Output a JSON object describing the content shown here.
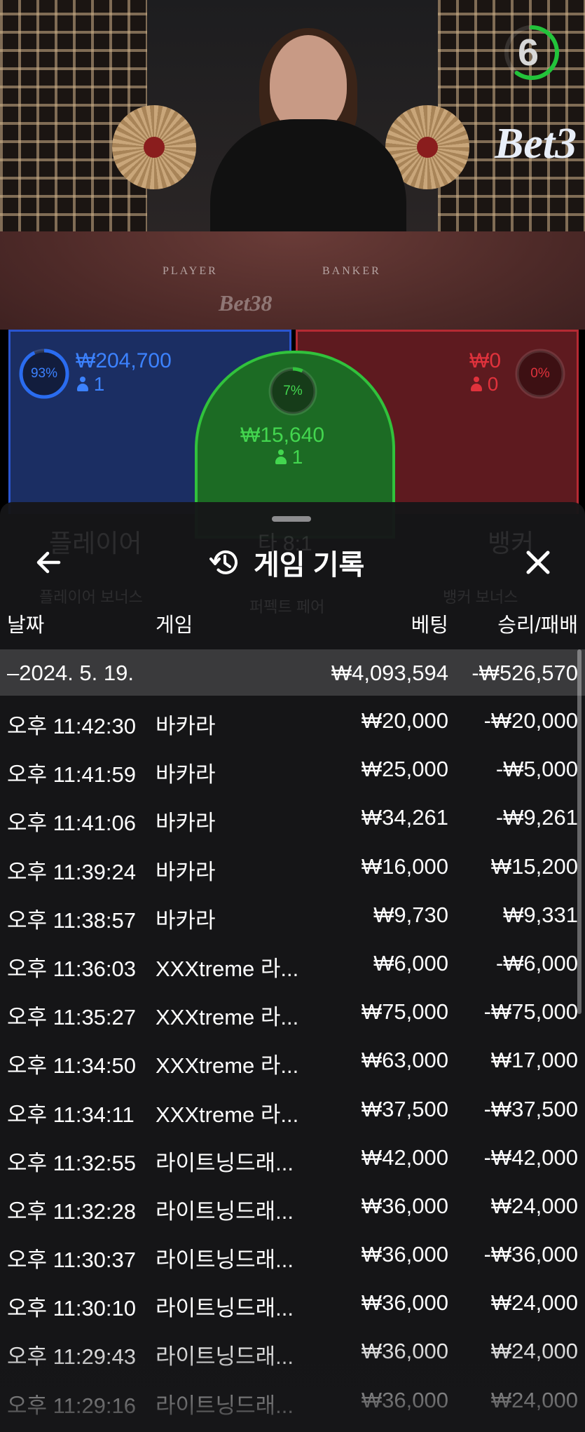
{
  "timer": {
    "seconds": "6",
    "progress": 0.6,
    "color": "#22c33a"
  },
  "video": {
    "felt_player": "PLAYER",
    "felt_banker": "BANKER",
    "watermark": "Bet38",
    "brand_right": "Bet3"
  },
  "bets": {
    "player": {
      "amount": "₩204,700",
      "count": "1",
      "percent": "93%",
      "percent_value": 0.93,
      "color": "#2a6cf0"
    },
    "tie": {
      "amount": "₩15,640",
      "count": "1",
      "percent": "7%",
      "percent_value": 0.07,
      "color": "#31c23c"
    },
    "banker": {
      "amount": "₩0",
      "count": "0",
      "percent": "0%",
      "percent_value": 0,
      "color": "#d2232f"
    }
  },
  "background_panel": {
    "player_label": "플레이어",
    "tie_label": "타 8:1",
    "banker_label": "뱅커",
    "player_bonus": "플레이어 보너스",
    "tie_bonus": "퍼펙트 페어",
    "banker_bonus": "뱅커 보너스"
  },
  "history": {
    "title": "게임 기록",
    "columns": {
      "date": "날짜",
      "game": "게임",
      "bet": "베팅",
      "winloss": "승리/패배"
    },
    "summary": {
      "date": "–2024. 5. 19.",
      "bet": "₩4,093,594",
      "winloss": "-₩526,570"
    },
    "rows": [
      {
        "time": "오후 11:42:30",
        "game": "바카라",
        "bet": "₩20,000",
        "winloss": "-₩20,000"
      },
      {
        "time": "오후 11:41:59",
        "game": "바카라",
        "bet": "₩25,000",
        "winloss": "-₩5,000"
      },
      {
        "time": "오후 11:41:06",
        "game": "바카라",
        "bet": "₩34,261",
        "winloss": "-₩9,261"
      },
      {
        "time": "오후 11:39:24",
        "game": "바카라",
        "bet": "₩16,000",
        "winloss": "₩15,200"
      },
      {
        "time": "오후 11:38:57",
        "game": "바카라",
        "bet": "₩9,730",
        "winloss": "₩9,331"
      },
      {
        "time": "오후 11:36:03",
        "game": "XXXtreme 라...",
        "bet": "₩6,000",
        "winloss": "-₩6,000"
      },
      {
        "time": "오후 11:35:27",
        "game": "XXXtreme 라...",
        "bet": "₩75,000",
        "winloss": "-₩75,000"
      },
      {
        "time": "오후 11:34:50",
        "game": "XXXtreme 라...",
        "bet": "₩63,000",
        "winloss": "₩17,000"
      },
      {
        "time": "오후 11:34:11",
        "game": "XXXtreme 라...",
        "bet": "₩37,500",
        "winloss": "-₩37,500"
      },
      {
        "time": "오후 11:32:55",
        "game": "라이트닝드래...",
        "bet": "₩42,000",
        "winloss": "-₩42,000"
      },
      {
        "time": "오후 11:32:28",
        "game": "라이트닝드래...",
        "bet": "₩36,000",
        "winloss": "₩24,000"
      },
      {
        "time": "오후 11:30:37",
        "game": "라이트닝드래...",
        "bet": "₩36,000",
        "winloss": "-₩36,000"
      },
      {
        "time": "오후 11:30:10",
        "game": "라이트닝드래...",
        "bet": "₩36,000",
        "winloss": "₩24,000"
      },
      {
        "time": "오후 11:29:43",
        "game": "라이트닝드래...",
        "bet": "₩36,000",
        "winloss": "₩24,000"
      },
      {
        "time": "오후 11:29:16",
        "game": "라이트닝드래...",
        "bet": "₩36,000",
        "winloss": "₩24,000"
      }
    ]
  }
}
